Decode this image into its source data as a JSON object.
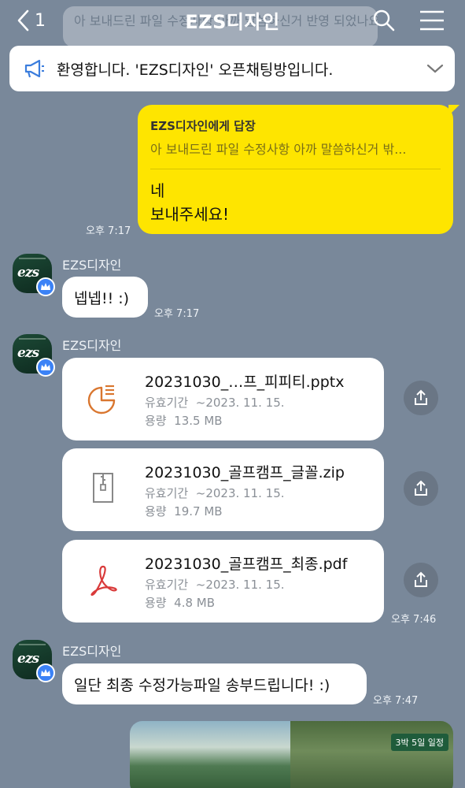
{
  "header": {
    "back_count": "1",
    "title": "EZS디자인",
    "faded_message": "아 보내드린 파일 수정사항 아까 말씀하신거 반영 되었나요 확인 부탁"
  },
  "notice": {
    "text": "환영합니다. 'EZS디자인' 오픈채팅방입니다."
  },
  "my_reply": {
    "reply_to": "EZS디자인에게 답장",
    "quote": "아 보내드린 파일 수정사항 아까 말씀하신거 밖...",
    "line1": "네",
    "line2": "보내주세요!",
    "time": "오후 7:17"
  },
  "messages": {
    "m1": {
      "sender": "EZS디자인",
      "text": "넵넵!! :)",
      "time": "오후 7:17"
    },
    "m2": {
      "sender": "EZS디자인",
      "time": "오후 7:46"
    },
    "m3": {
      "sender": "EZS디자인",
      "text": "일단 최종 수정가능파일 송부드립니다! :)",
      "time": "오후 7:47"
    }
  },
  "files": [
    {
      "name": "20231030_…프_피피티.pptx",
      "expiry_label": "유효기간",
      "expiry": "~2023. 11. 15.",
      "size_label": "용량",
      "size": "13.5 MB",
      "icon": "pptx-icon"
    },
    {
      "name": "20231030_골프캠프_글꼴.zip",
      "expiry_label": "유효기간",
      "expiry": "~2023. 11. 15.",
      "size_label": "용량",
      "size": "19.7 MB",
      "icon": "zip-icon"
    },
    {
      "name": "20231030_골프캠프_최종.pdf",
      "expiry_label": "유효기간",
      "expiry": "~2023. 11. 15.",
      "size_label": "용량",
      "size": "4.8 MB",
      "icon": "pdf-icon"
    }
  ],
  "photo": {
    "tag": "3박 5일 일정"
  },
  "avatar": {
    "logo": "ezs"
  },
  "colors": {
    "background": "#79889a",
    "my_bubble": "#fee500",
    "crown_badge": "#3b82f6"
  }
}
